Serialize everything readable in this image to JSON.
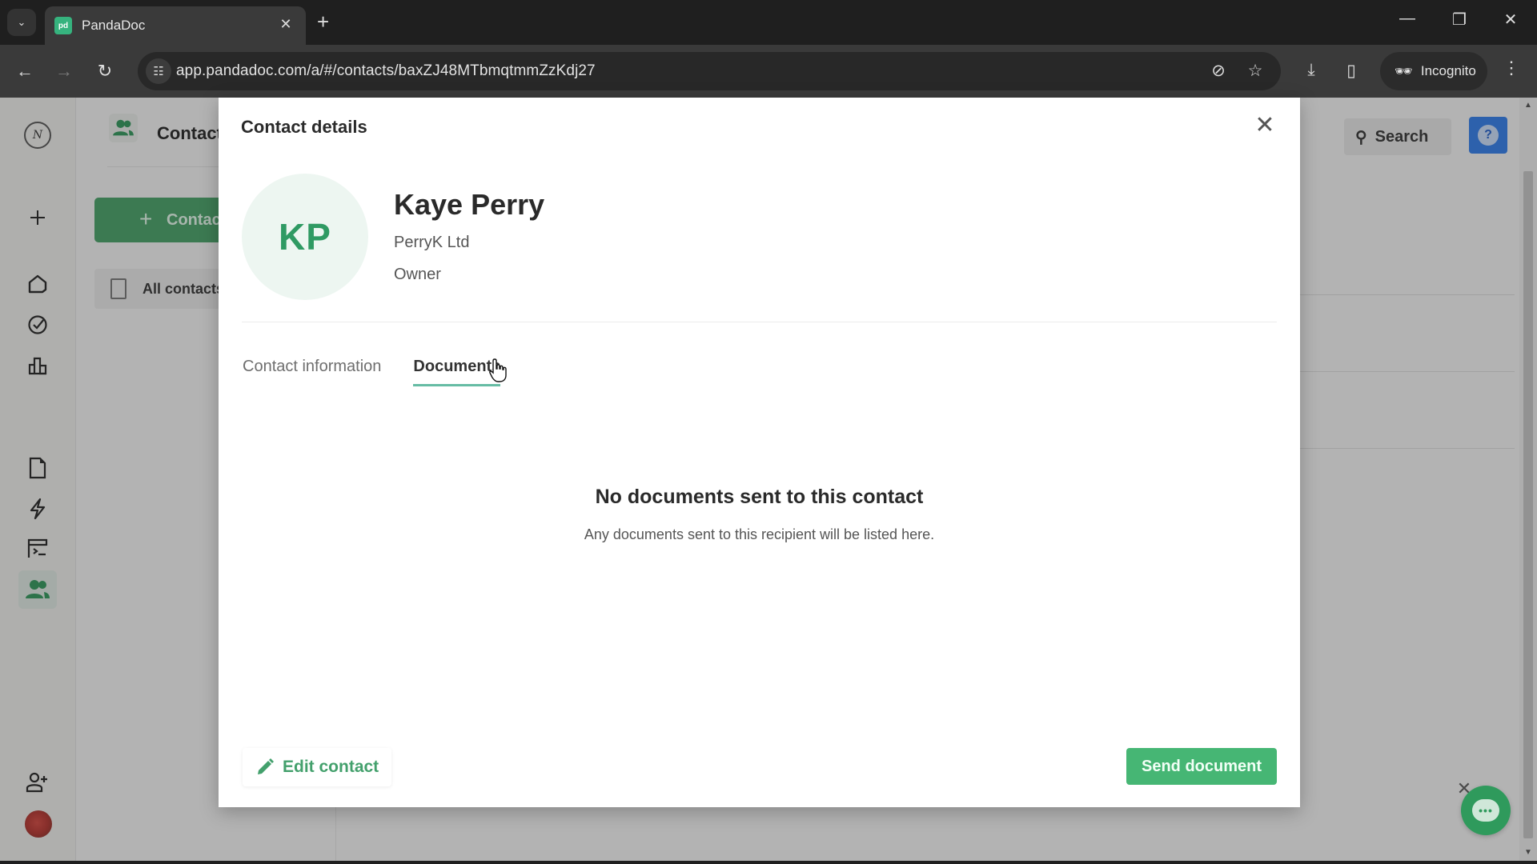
{
  "browser": {
    "tab_title": "PandaDoc",
    "favicon_text": "pd",
    "url": "app.pandadoc.com/a/#/contacts/baxZJ48MTbmqtmmZzKdj27",
    "incognito_label": "Incognito",
    "icons": {
      "tab_list": "chevron-down-icon",
      "tab_close": "close-icon",
      "new_tab": "plus-icon",
      "minimize": "minimize-icon",
      "restore": "restore-icon",
      "close_window": "close-icon",
      "back": "arrow-left-icon",
      "forward": "arrow-right-icon",
      "reload": "reload-icon",
      "site_info": "tune-icon",
      "eye_off": "eye-off-icon",
      "bookmark": "star-icon",
      "download": "download-icon",
      "side_panel": "side-panel-icon",
      "menu": "more-vertical-icon"
    },
    "glyphs": {
      "tab_list": "⌄",
      "tab_close": "✕",
      "new_tab": "+",
      "minimize": "—",
      "restore": "❐",
      "close_window": "✕",
      "back": "←",
      "forward": "→",
      "reload": "↻",
      "site_info": "☷",
      "eye_off": "⊘",
      "bookmark": "☆",
      "download": "⤓",
      "side_panel": "▯",
      "incognito": "🕶",
      "menu": "⋮"
    }
  },
  "app": {
    "brand_color": "#47a468",
    "logo_text": "N",
    "left_nav": [
      {
        "name": "create",
        "icon": "plus-icon",
        "glyph": "+"
      },
      {
        "name": "home",
        "icon": "home-icon"
      },
      {
        "name": "tasks",
        "icon": "check-circle-icon"
      },
      {
        "name": "reports",
        "icon": "bar-chart-icon"
      },
      {
        "name": "documents",
        "icon": "document-icon"
      },
      {
        "name": "automation",
        "icon": "lightning-icon"
      },
      {
        "name": "templates",
        "icon": "template-icon"
      },
      {
        "name": "contacts",
        "icon": "contacts-icon",
        "active": true
      },
      {
        "name": "invite-user",
        "icon": "user-plus-icon"
      }
    ],
    "subnav": {
      "title": "Contacts",
      "add_button": "Contact",
      "all_contacts": "All contacts"
    },
    "header": {
      "search_label": "Search",
      "help_glyph": "?"
    }
  },
  "modal": {
    "title": "Contact details",
    "close_glyph": "✕",
    "contact": {
      "initials": "KP",
      "name": "Kaye Perry",
      "company": "PerryK Ltd",
      "role": "Owner"
    },
    "tabs": [
      {
        "label": "Contact information",
        "active": false
      },
      {
        "label": "Documents",
        "active": true
      }
    ],
    "empty_state": {
      "title": "No documents sent to this contact",
      "subtitle": "Any documents sent to this recipient will be listed here."
    },
    "edit_button": "Edit contact",
    "send_button": "Send document"
  },
  "chat_widget": {
    "close_glyph": "✕",
    "bubble_glyph": "•••"
  }
}
